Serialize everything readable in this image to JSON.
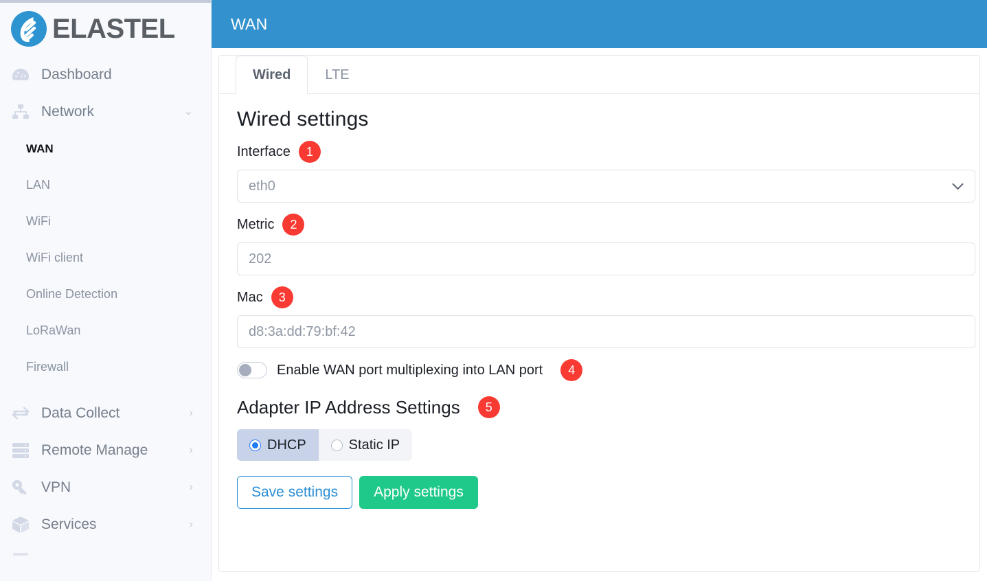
{
  "brand": {
    "name": "ELASTEL",
    "logo_icon": "elastel-logo-icon"
  },
  "sidebar": {
    "items": [
      {
        "label": "Dashboard",
        "icon": "dashboard-gauge-icon",
        "chevron": ""
      },
      {
        "label": "Network",
        "icon": "network-sitemap-icon",
        "chevron": "⌄"
      }
    ],
    "network_children": [
      {
        "label": "WAN",
        "active": true
      },
      {
        "label": "LAN",
        "active": false
      },
      {
        "label": "WiFi",
        "active": false
      },
      {
        "label": "WiFi client",
        "active": false
      },
      {
        "label": "Online Detection",
        "active": false
      },
      {
        "label": "LoRaWan",
        "active": false
      },
      {
        "label": "Firewall",
        "active": false
      }
    ],
    "items_bottom": [
      {
        "label": "Data Collect",
        "icon": "data-exchange-icon",
        "chevron": "›"
      },
      {
        "label": "Remote Manage",
        "icon": "server-rack-icon",
        "chevron": "›"
      },
      {
        "label": "VPN",
        "icon": "key-icon",
        "chevron": "›"
      },
      {
        "label": "Services",
        "icon": "cube-box-icon",
        "chevron": "›"
      }
    ]
  },
  "header": {
    "title": "WAN"
  },
  "tabs": [
    {
      "label": "Wired",
      "active": true
    },
    {
      "label": "LTE",
      "active": false
    }
  ],
  "form": {
    "section_title": "Wired settings",
    "interface": {
      "label": "Interface",
      "badge": "1",
      "value": "eth0",
      "chevron_icon": "chevron-down-icon"
    },
    "metric": {
      "label": "Metric",
      "badge": "2",
      "value": "202"
    },
    "mac": {
      "label": "Mac",
      "badge": "3",
      "value": "d8:3a:dd:79:bf:42"
    },
    "multiplex": {
      "label": "Enable WAN port multiplexing into LAN port",
      "badge": "4",
      "enabled": false
    },
    "adapter_ip": {
      "title": "Adapter IP Address Settings",
      "badge": "5",
      "options": [
        {
          "label": "DHCP",
          "selected": true
        },
        {
          "label": "Static IP",
          "selected": false
        }
      ]
    },
    "buttons": {
      "save": "Save settings",
      "apply": "Apply settings"
    }
  },
  "colors": {
    "header_blue": "#3392ce",
    "badge_red": "#f93a33",
    "apply_green": "#1fc98a",
    "save_blue": "#2b8fd6",
    "radio_selected_bg": "#c8d3ea",
    "sidebar_bg": "#f7f9fc"
  }
}
